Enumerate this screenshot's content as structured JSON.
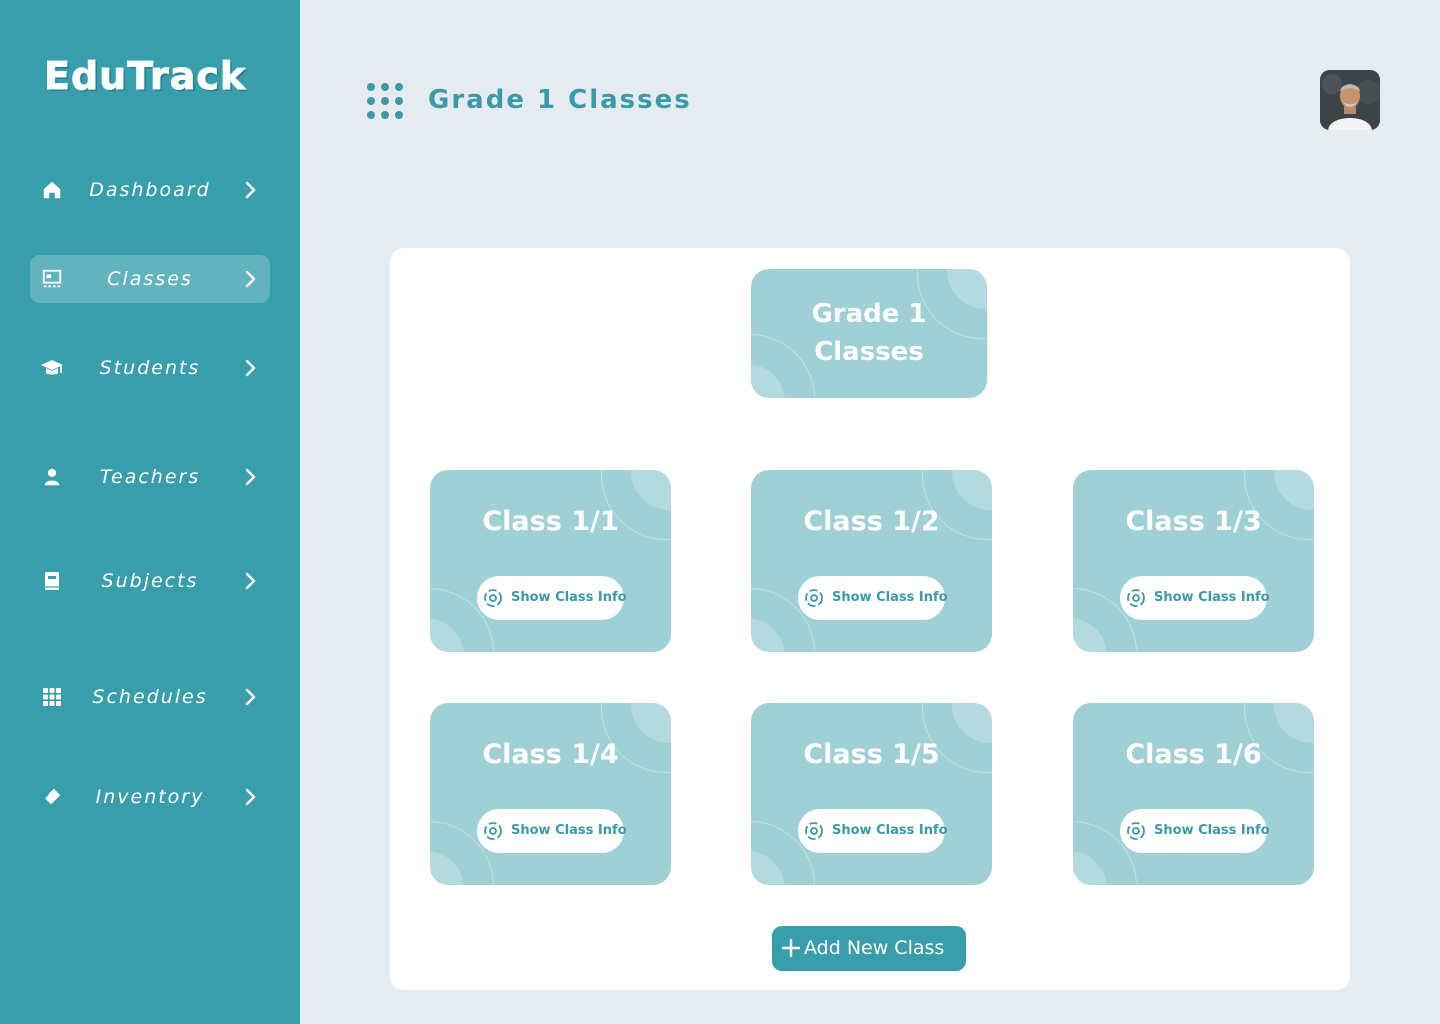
{
  "sidebar": {
    "logo": "EduTrack",
    "items": [
      {
        "label": "Dashboard",
        "icon": "home-icon",
        "active": false
      },
      {
        "label": "Classes",
        "icon": "classes-icon",
        "active": true
      },
      {
        "label": "Students",
        "icon": "graduation-cap-icon",
        "active": false
      },
      {
        "label": "Teachers",
        "icon": "person-icon",
        "active": false
      },
      {
        "label": "Subjects",
        "icon": "book-icon",
        "active": false
      },
      {
        "label": "Schedules",
        "icon": "calendar-grid-icon",
        "active": false
      },
      {
        "label": "Inventory",
        "icon": "eraser-icon",
        "active": false
      }
    ]
  },
  "header": {
    "title": "Grade 1 Classes",
    "menu_icon": "dots-grid-icon",
    "avatar": "user-avatar"
  },
  "main": {
    "grade_card_title": "Grade 1 Classes",
    "classes": [
      {
        "name": "Class 1/1",
        "button": "Show Class Info"
      },
      {
        "name": "Class 1/2",
        "button": "Show Class Info"
      },
      {
        "name": "Class 1/3",
        "button": "Show Class Info"
      },
      {
        "name": "Class 1/4",
        "button": "Show Class Info"
      },
      {
        "name": "Class 1/5",
        "button": "Show Class Info"
      },
      {
        "name": "Class 1/6",
        "button": "Show Class Info"
      }
    ],
    "add_button": "Add New Class"
  },
  "colors": {
    "sidebar": "#389eac",
    "accent": "#3a9aaa",
    "card": "#9ed0d6",
    "background": "#e5ebee"
  }
}
